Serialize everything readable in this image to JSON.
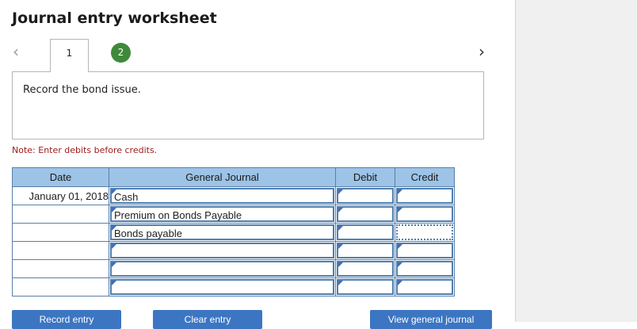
{
  "header": {
    "title": "Journal entry worksheet"
  },
  "tabs": [
    {
      "label": "1"
    },
    {
      "label": "2"
    }
  ],
  "instruction": "Record the bond issue.",
  "note": "Note: Enter debits before credits.",
  "table": {
    "headers": {
      "date": "Date",
      "general_journal": "General Journal",
      "debit": "Debit",
      "credit": "Credit"
    },
    "rows": [
      {
        "date": "January 01, 2018",
        "account": "Cash",
        "debit": "",
        "credit": ""
      },
      {
        "date": "",
        "account": "Premium on Bonds Payable",
        "debit": "",
        "credit": ""
      },
      {
        "date": "",
        "account": "Bonds payable",
        "debit": "",
        "credit": ""
      },
      {
        "date": "",
        "account": "",
        "debit": "",
        "credit": ""
      },
      {
        "date": "",
        "account": "",
        "debit": "",
        "credit": ""
      },
      {
        "date": "",
        "account": "",
        "debit": "",
        "credit": ""
      }
    ]
  },
  "buttons": {
    "record_entry": "Record entry",
    "clear_entry": "Clear entry",
    "view_general_journal": "View general journal"
  },
  "colors": {
    "accent": "#3c76c2",
    "tab_green": "#3e8a3a",
    "table_header": "#9dc3e6",
    "note_red": "#9b1a1a"
  },
  "icons": {
    "prev": "chevron-left-icon",
    "next": "chevron-right-icon"
  }
}
